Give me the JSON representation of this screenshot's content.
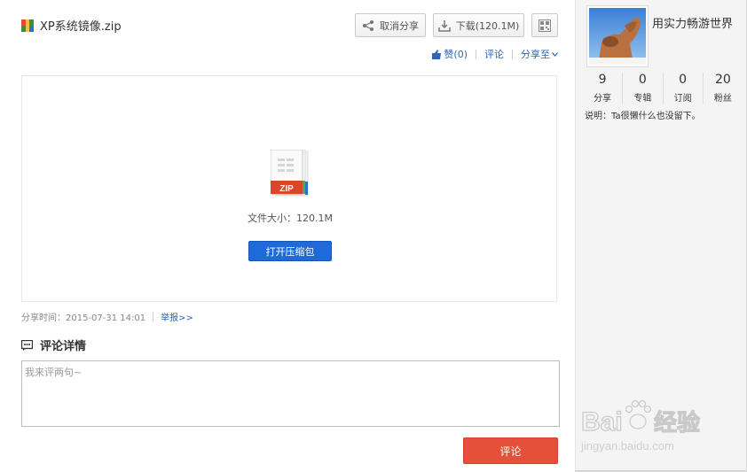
{
  "file": {
    "name": "XP系统镜像.zip",
    "size_label": "文件大小：120.1M",
    "type_badge": "ZIP"
  },
  "toolbar": {
    "cancel_share": "取消分享",
    "download": "下载(120.1M)",
    "qr": "qr-code-icon"
  },
  "actions": {
    "like": "赞(0)",
    "comment": "评论",
    "share_to": "分享至"
  },
  "preview": {
    "open_button": "打开压缩包"
  },
  "meta": {
    "share_time": "分享时间：2015-07-31 14:01",
    "report": "举报>>"
  },
  "comments": {
    "heading": "评论详情",
    "placeholder": "我来评两句~",
    "submit": "评论"
  },
  "profile": {
    "username": "用实力畅游世界",
    "stats": [
      {
        "value": "9",
        "label": "分享"
      },
      {
        "value": "0",
        "label": "专辑"
      },
      {
        "value": "0",
        "label": "订阅"
      },
      {
        "value": "20",
        "label": "粉丝"
      }
    ],
    "description": "说明：Ta很懒什么也没留下。"
  },
  "watermark": {
    "brand_left": "Bai",
    "brand_right": "经验",
    "url": "jingyan.baidu.com"
  },
  "colors": {
    "link": "#2d64b3",
    "primary_button": "#1f6ad9",
    "submit_button": "#e5503b",
    "sidebar_bg": "#f4f4f4"
  }
}
